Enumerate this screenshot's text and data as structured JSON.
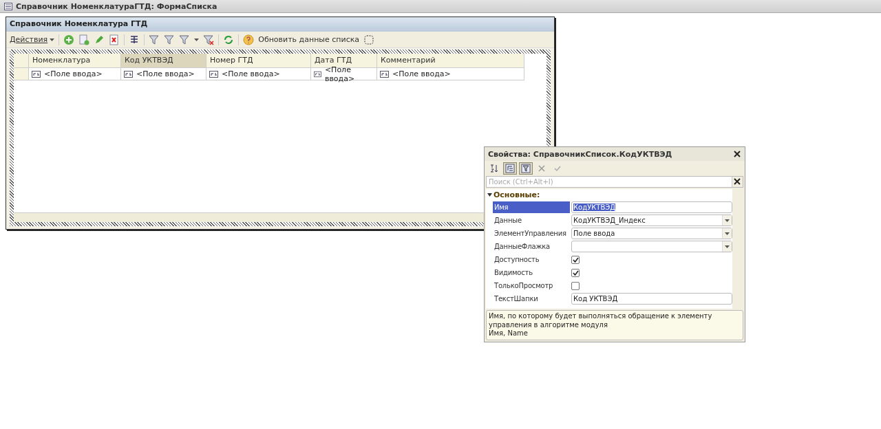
{
  "window": {
    "title": "Справочник НоменклатураГТД: ФормаСписка"
  },
  "form": {
    "title": "Справочник Номенклатура ГТД",
    "toolbar": {
      "actions": "Действия",
      "refresh_label": "Обновить данные списка"
    },
    "table": {
      "columns": [
        {
          "label": "Номенклатура",
          "selected": false,
          "cell": "<Поле ввода>"
        },
        {
          "label": "Код УКТВЭД",
          "selected": true,
          "cell": "<Поле ввода>"
        },
        {
          "label": "Номер ГТД",
          "selected": false,
          "cell": "<Поле ввода>"
        },
        {
          "label": "Дата ГТД",
          "selected": false,
          "cell": "<Поле ввода>"
        },
        {
          "label": "Комментарий",
          "selected": false,
          "cell": "<Поле ввода>"
        }
      ]
    }
  },
  "properties": {
    "title": "Свойства: СправочникСписок.КодУКТВЭД",
    "toolbar": [
      {
        "kind": "sort",
        "selected": false
      },
      {
        "kind": "tree",
        "selected": true
      },
      {
        "kind": "filter",
        "selected": true
      },
      {
        "kind": "cancel",
        "selected": false
      },
      {
        "kind": "apply",
        "selected": false
      }
    ],
    "search": {
      "placeholder": "Поиск (Ctrl+Alt+I)"
    },
    "group": {
      "label": "Основные:",
      "expanded": true
    },
    "rows": [
      {
        "name": "Имя",
        "kind": "text",
        "value": "КодУКТВЭД",
        "selected": true
      },
      {
        "name": "Данные",
        "kind": "select",
        "value": "КодУКТВЭД_Индекс",
        "selected": false
      },
      {
        "name": "ЭлементУправления",
        "kind": "select",
        "value": "Поле ввода",
        "selected": false
      },
      {
        "name": "ДанныеФлажка",
        "kind": "select",
        "selected": false
      },
      {
        "name": "Доступность",
        "kind": "checkbox",
        "checked": true,
        "selected": false
      },
      {
        "name": "Видимость",
        "kind": "checkbox",
        "checked": true,
        "selected": false
      },
      {
        "name": "ТолькоПросмотр",
        "kind": "checkbox",
        "checked": false,
        "selected": false
      },
      {
        "name": "ТекстШапки",
        "kind": "text",
        "value": "Код УКТВЭД",
        "selected": false
      }
    ],
    "description": [
      "Имя, по которому будет выполняться обращение к элементу управления в алгоритме модуля",
      "Имя, Name"
    ]
  }
}
